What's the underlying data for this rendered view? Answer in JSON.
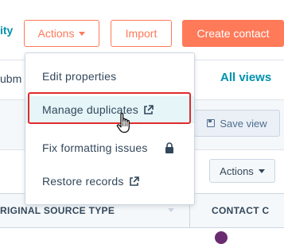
{
  "toolbar": {
    "cut_left_text": "ity",
    "actions_label": "Actions",
    "import_label": "Import",
    "create_label": "Create contact"
  },
  "page": {
    "cut_submit_text": "ubm",
    "all_views_label": "All views",
    "save_view_label": "Save view",
    "table_actions_label": "Actions"
  },
  "table": {
    "columns": [
      {
        "label": "RIGINAL SOURCE TYPE"
      },
      {
        "label": "CONTACT C"
      }
    ]
  },
  "menu": {
    "items": [
      {
        "label": "Edit properties",
        "icon": null
      },
      {
        "label": "Manage duplicates",
        "icon": "external-link-icon"
      },
      {
        "label": "Fix formatting issues",
        "icon": "lock-icon"
      },
      {
        "label": "Restore records",
        "icon": "external-link-icon"
      }
    ]
  },
  "colors": {
    "accent": "#ff7a59",
    "link": "#0091ae",
    "text": "#33475b",
    "highlight": "#e02b2b",
    "menu_hover": "#e5f5f8"
  }
}
